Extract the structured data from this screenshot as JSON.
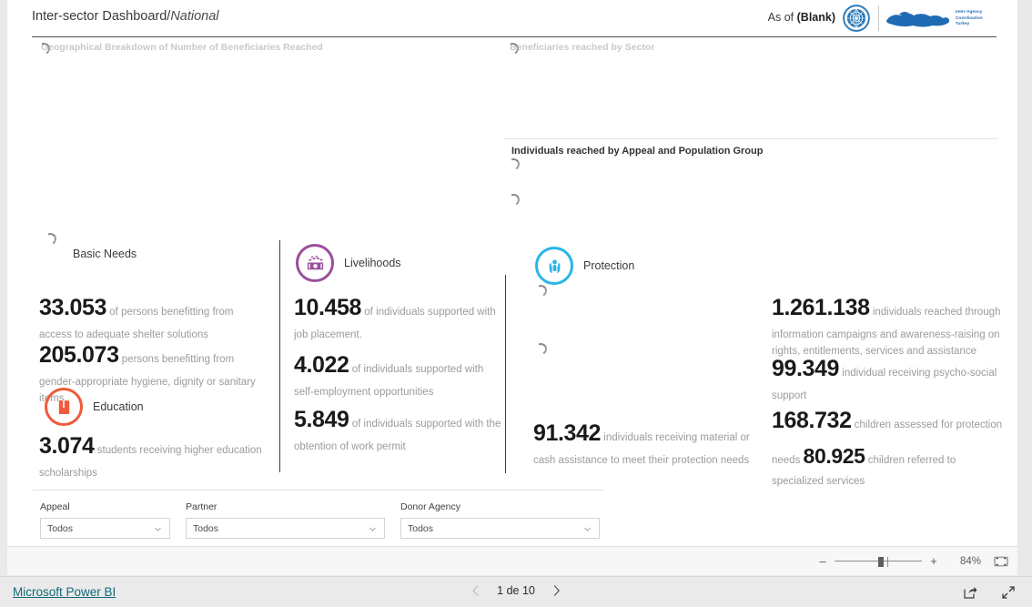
{
  "report": {
    "title_main": "Inter-sector Dashboard/",
    "title_sub": "National",
    "asof_label": "As of ",
    "asof_value": "(Blank)",
    "logo_un": "un-emblem-logo",
    "logo_iac": "inter-agency-coordination-turkey-logo",
    "iac_logo_text": "Inter-Agency Coordination Turkey"
  },
  "visuals": {
    "map_title": "Geographical Breakdown of Number of Beneficiaries Reached",
    "sector_title": "Beneficiaries reached by Sector",
    "appeal_title": "Individuals reached by Appeal and Population Group"
  },
  "sectors": [
    {
      "name": "Basic Needs",
      "icon": "basic-needs-icon",
      "color": "#8e44ad",
      "stats": [
        {
          "num": "33.053",
          "text": "of persons benefitting from access to adequate shelter solutions"
        },
        {
          "num": "205.073",
          "text": "persons benefitting from gender-appropriate hygiene, dignity or sanitary items"
        }
      ]
    },
    {
      "name": "Education",
      "icon": "education-book-icon",
      "color": "#f05a3c",
      "stats": [
        {
          "num": "3.074",
          "text": "students receiving higher education scholarships"
        }
      ]
    },
    {
      "name": "Livelihoods",
      "icon": "livelihoods-money-icon",
      "color": "#9b4f9b",
      "stats": [
        {
          "num": "10.458",
          "text": "of individuals supported with job placement."
        },
        {
          "num": "4.022",
          "text": "of individuals supported with self-employment opportunities"
        },
        {
          "num": "5.849",
          "text": "of individuals supported with the obtention of work permit"
        }
      ]
    },
    {
      "name": "Protection",
      "icon": "protection-hands-icon",
      "color": "#29b6e8",
      "stats": [
        {
          "num": "91.342",
          "text": "individuals receiving material or cash assistance to meet their protection needs"
        }
      ]
    }
  ],
  "protection_right": {
    "stat1_num": "1.261.138",
    "stat1_text": "individuals reached through information campaigns and awareness-raising on rights, entitlements, services and assistance",
    "stat2_num": "99.349",
    "stat2_text": "individual receiving psycho-social support",
    "stat3_num": "168.732",
    "stat3_text_a": "children assessed for protection",
    "stat3_text_b": "needs",
    "stat4_num": "80.925",
    "stat4_text": "children referred to specialized services"
  },
  "slicers": [
    {
      "label": "Appeal",
      "value": "Todos",
      "chevron": "chevron-down-icon"
    },
    {
      "label": "Partner",
      "value": "Todos",
      "chevron": "chevron-down-icon"
    },
    {
      "label": "Donor Agency",
      "value": "Todos",
      "chevron": "chevron-down-icon"
    }
  ],
  "statusbar": {
    "zoom_out": "–",
    "zoom_in": "+",
    "zoom_level": "84%",
    "fit_icon": "fit-to-page-icon"
  },
  "footer": {
    "brand": "Microsoft Power BI",
    "prev_icon": "chevron-left-icon",
    "page_label": "1 de 10",
    "next_icon": "chevron-right-icon",
    "share_icon": "share-icon",
    "fullscreen_icon": "fullscreen-icon"
  }
}
